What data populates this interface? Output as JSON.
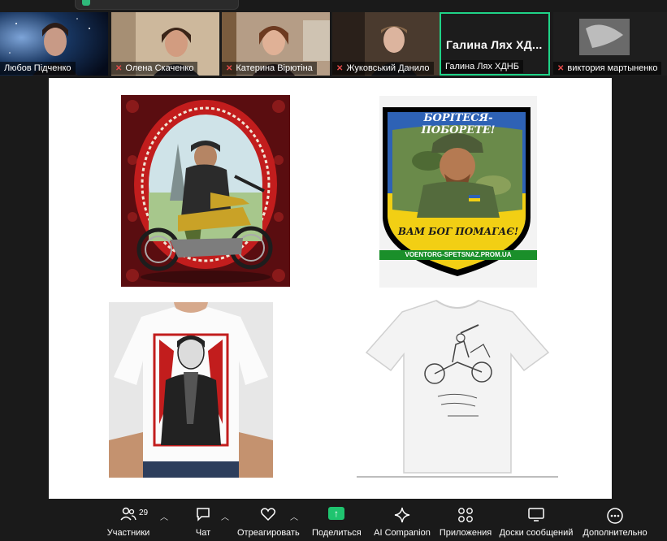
{
  "participants": [
    {
      "name": "Любов Підченко",
      "muted": false
    },
    {
      "name": "Олена Скаченко",
      "muted": true
    },
    {
      "name": "Катерина Вірютіна",
      "muted": true
    },
    {
      "name": "Жуковський Данило",
      "muted": true
    },
    {
      "name": "Галина Лях ХДНБ",
      "display_name": "Галина Лях ХД...",
      "muted": false,
      "active": true
    },
    {
      "name": "виктория мартыненко",
      "muted": true
    }
  ],
  "shared_content": {
    "patch_top_text": "БОРІТЕСЯ-ПОБОРЕТЕ!",
    "patch_bottom_text": "ВАМ БОГ ПОМАГАЄ!",
    "patch_url": "VOENTORG-SPETSNAZ.PROM.UA"
  },
  "toolbar": {
    "participants_label": "Участники",
    "participants_count": "29",
    "chat_label": "Чат",
    "react_label": "Отреагировать",
    "share_label": "Поделиться",
    "ai_label": "AI Companion",
    "apps_label": "Приложения",
    "boards_label": "Доски сообщений",
    "more_label": "Дополнительно"
  },
  "colors": {
    "accent_green": "#1fd387",
    "share_green": "#1fc46f",
    "muted_red": "#e84b4b"
  }
}
